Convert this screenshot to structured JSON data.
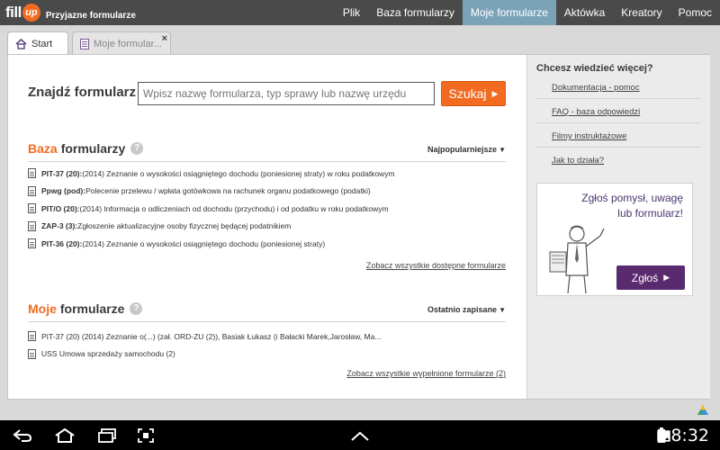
{
  "app": {
    "logo_text": "fill",
    "logo_badge": "up",
    "tagline": "Przyjazne formularze"
  },
  "nav": [
    {
      "label": "Plik",
      "active": false
    },
    {
      "label": "Baza formularzy",
      "active": false
    },
    {
      "label": "Moje formularze",
      "active": true
    },
    {
      "label": "Aktówka",
      "active": false
    },
    {
      "label": "Kreatory",
      "active": false
    },
    {
      "label": "Pomoc",
      "active": false
    }
  ],
  "tabs": [
    {
      "label": "Start",
      "icon": "home-icon"
    },
    {
      "label": "Moje formular...",
      "icon": "form-icon",
      "close": "×"
    }
  ],
  "search": {
    "label": "Znajdź formularz",
    "placeholder": "Wpisz nazwę formularza, typ sprawy lub nazwę urzędu",
    "button": "Szukaj",
    "button_arrow": "▶"
  },
  "baza": {
    "title_accent": "Baza",
    "title_rest": "formularzy",
    "help": "?",
    "sort": "Najpopularniejsze",
    "sort_caret": "▼",
    "items": [
      {
        "code": "PIT-37 (20):",
        "desc": " (2014) Zeznanie o wysokości osiągniętego dochodu (poniesionej straty) w roku podatkowym"
      },
      {
        "code": "Ppwg (pod):",
        "desc": " Polecenie przelewu / wpłata gotówkowa na rachunek organu podatkowego (podatki)"
      },
      {
        "code": "PIT/O (20):",
        "desc": " (2014) Informacja o odliczeniach od dochodu (przychodu) i od podatku w roku podatkowym"
      },
      {
        "code": "ZAP-3 (3):",
        "desc": " Zgłoszenie aktualizacyjne osoby fizycznej będącej podatnikiem"
      },
      {
        "code": "PIT-36 (20):",
        "desc": " (2014) Zeznanie o wysokości osiągniętego dochodu (poniesionej straty)"
      }
    ],
    "more": "Zobacz wszystkie dostępne formularze"
  },
  "moje": {
    "title_accent": "Moje",
    "title_rest": "formularze",
    "help": "?",
    "sort": "Ostatnio zapisane",
    "sort_caret": "▼",
    "items": [
      {
        "text": "PIT-37 (20) (2014) Zeznanie o(...) (zał. ORD-ZU (2)), Basiak Łukasz (i Bałacki Marek,Jarosław, Ma..."
      },
      {
        "text": "USS Umowa sprzedaży samochodu (2)"
      }
    ],
    "more": "Zobacz wszystkie wypełnione formularze (2)"
  },
  "sidebar": {
    "title": "Chcesz wiedzieć więcej?",
    "links": [
      "Dokumentacja - pomoc",
      "FAQ - baza odpowiedzi",
      "Filmy instruktażowe",
      "Jak to działa?"
    ],
    "promo_line1": "Zgłoś pomysł, uwagę",
    "promo_line2": "lub formularz!",
    "promo_button": "Zgłoś",
    "promo_arrow": "▶"
  },
  "system": {
    "clock": "8:32",
    "hash": "#"
  },
  "colors": {
    "accent": "#f26b21",
    "nav_active": "#7aa3b8",
    "topbar": "#4a4a4a",
    "promo_button": "#5a2a6e"
  }
}
